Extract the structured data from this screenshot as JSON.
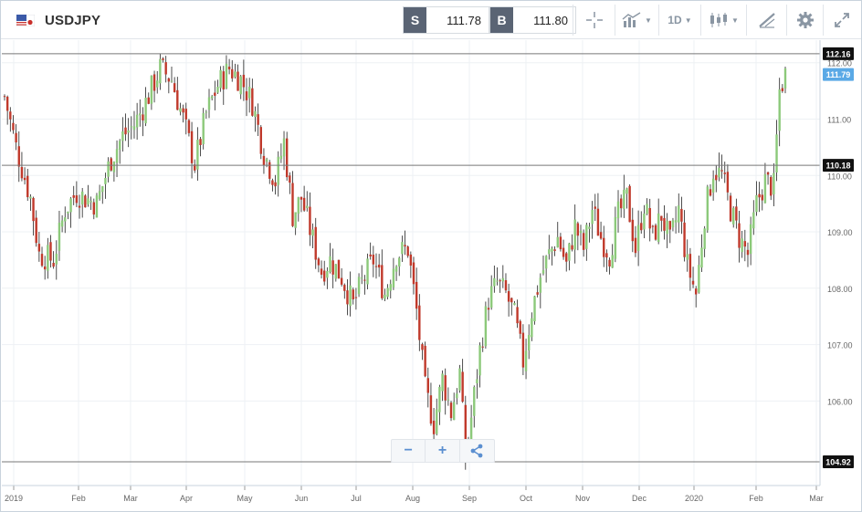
{
  "header": {
    "symbol": "USDJPY",
    "flag_icon": "us-jp-flag-icon",
    "sell": {
      "tag": "S",
      "price": "111.78"
    },
    "buy": {
      "tag": "B",
      "price": "111.80"
    },
    "timeframe": "1D",
    "tools": [
      "crosshair-icon",
      "indicators-icon",
      "timeframe-selector",
      "candlestick-icon",
      "draw-icon",
      "gear-icon",
      "expand-icon"
    ]
  },
  "zoom": {
    "minus": "−",
    "plus": "+",
    "share_icon": "share-icon"
  },
  "colors": {
    "up": "#8cc97a",
    "down": "#c0392b",
    "wick": "#222222",
    "grid": "#eef1f4",
    "hline": "#777777",
    "last_price": "#5aa9e6",
    "label_bg": "#111111"
  },
  "chart_data": {
    "type": "candlestick",
    "ylim": [
      104.5,
      112.4
    ],
    "y_ticks": [
      "112.00",
      "111.00",
      "110.00",
      "109.00",
      "108.00",
      "107.00",
      "106.00"
    ],
    "x_ticks": [
      "2019",
      "Feb",
      "Mar",
      "Apr",
      "May",
      "Jun",
      "Jul",
      "Aug",
      "Sep",
      "Oct",
      "Nov",
      "Dec",
      "2020",
      "Feb",
      "Mar"
    ],
    "horizontal_lines": [
      {
        "value": 112.16,
        "label": "112.16"
      },
      {
        "value": 110.18,
        "label": "110.18"
      },
      {
        "value": 104.92,
        "label": "104.92"
      }
    ],
    "last_price": {
      "value": 111.79,
      "label": "111.79"
    },
    "close_path": [
      [
        0,
        111.4
      ],
      [
        4,
        110.5
      ],
      [
        9,
        109.6
      ],
      [
        12,
        108.6
      ],
      [
        17,
        108.5
      ],
      [
        21,
        109.4
      ],
      [
        25,
        109.7
      ],
      [
        28,
        109.6
      ],
      [
        32,
        109.5
      ],
      [
        37,
        110.3
      ],
      [
        41,
        110.7
      ],
      [
        45,
        110.9
      ],
      [
        49,
        111.3
      ],
      [
        54,
        111.9
      ],
      [
        58,
        111.7
      ],
      [
        62,
        111.0
      ],
      [
        66,
        110.2
      ],
      [
        70,
        111.1
      ],
      [
        74,
        111.6
      ],
      [
        78,
        111.9
      ],
      [
        82,
        111.7
      ],
      [
        86,
        111.3
      ],
      [
        90,
        110.4
      ],
      [
        94,
        109.9
      ],
      [
        97,
        110.6
      ],
      [
        100,
        109.3
      ],
      [
        103,
        109.6
      ],
      [
        110,
        108.3
      ],
      [
        113,
        108.5
      ],
      [
        117,
        108.2
      ],
      [
        121,
        107.7
      ],
      [
        124,
        108.1
      ],
      [
        128,
        108.5
      ],
      [
        132,
        107.9
      ],
      [
        136,
        108.6
      ],
      [
        140,
        108.7
      ],
      [
        143,
        107.6
      ],
      [
        146,
        106.2
      ],
      [
        149,
        105.6
      ],
      [
        152,
        106.4
      ],
      [
        155,
        105.8
      ],
      [
        158,
        106.5
      ],
      [
        160,
        105.0
      ],
      [
        162,
        105.7
      ],
      [
        165,
        106.9
      ],
      [
        168,
        107.8
      ],
      [
        171,
        108.1
      ],
      [
        174,
        107.9
      ],
      [
        177,
        107.5
      ],
      [
        180,
        106.7
      ],
      [
        183,
        107.6
      ],
      [
        186,
        108.2
      ],
      [
        189,
        108.6
      ],
      [
        192,
        108.9
      ],
      [
        195,
        108.4
      ],
      [
        198,
        109.1
      ],
      [
        201,
        108.7
      ],
      [
        204,
        109.4
      ],
      [
        207,
        108.9
      ],
      [
        210,
        108.6
      ],
      [
        213,
        109.3
      ],
      [
        216,
        109.6
      ],
      [
        219,
        108.7
      ],
      [
        222,
        109.5
      ],
      [
        225,
        108.9
      ],
      [
        228,
        109.3
      ],
      [
        231,
        108.8
      ],
      [
        234,
        109.4
      ],
      [
        237,
        108.4
      ],
      [
        240,
        107.9
      ],
      [
        243,
        109.3
      ],
      [
        246,
        110.1
      ],
      [
        249,
        110.0
      ],
      [
        252,
        109.4
      ],
      [
        255,
        108.9
      ],
      [
        258,
        108.6
      ],
      [
        261,
        109.5
      ],
      [
        264,
        109.9
      ],
      [
        267,
        109.8
      ],
      [
        269,
        111.5
      ],
      [
        271,
        111.8
      ]
    ]
  }
}
